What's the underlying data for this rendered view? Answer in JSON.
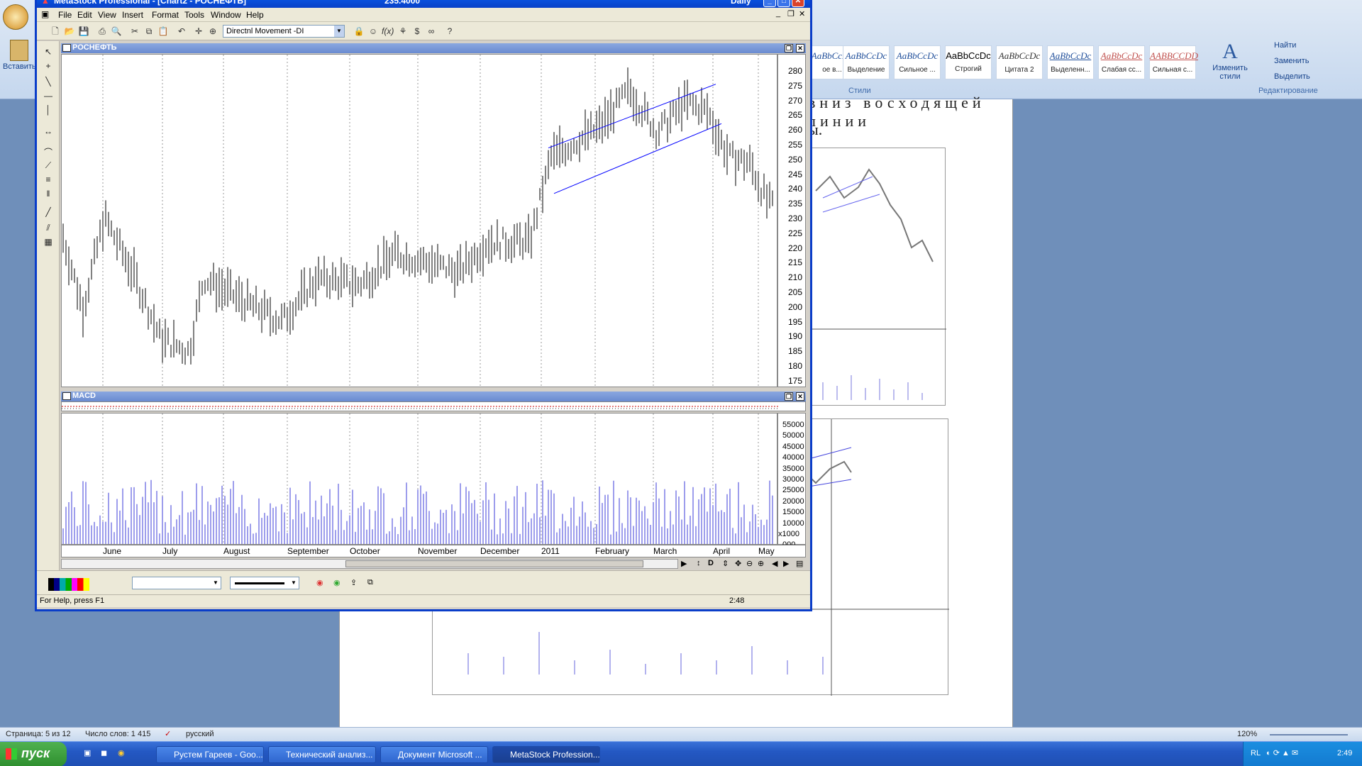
{
  "word": {
    "insert_label": "Вставить",
    "styles": [
      {
        "sample": "AaBbCcDc",
        "name": "ое в..."
      },
      {
        "sample": "AaBbCcDc",
        "name": "Выделение"
      },
      {
        "sample": "AaBbCcDc",
        "name": "Сильное ..."
      },
      {
        "sample": "AaBbCcDc",
        "name": "Строгий"
      },
      {
        "sample": "AaBbCcDc",
        "name": "Цитата 2"
      },
      {
        "sample": "AaBbCcDc",
        "name": "Выделенн..."
      },
      {
        "sample": "AaBbCcDc",
        "name": "Слабая сс..."
      },
      {
        "sample": "AABBCCDD",
        "name": "Сильная с..."
      }
    ],
    "change_styles": "Изменить стили",
    "styles_group": "Стили",
    "find": "Найти",
    "replace": "Заменить",
    "select": "Выделить",
    "editing_group": "Редактирование",
    "doc_text_line1": "вниз восходящей линии",
    "doc_text_line2": "ы.",
    "status": {
      "page": "Страница: 5 из 12",
      "words": "Число слов: 1 415",
      "lang": "русский",
      "zoom": "120%"
    }
  },
  "metastock": {
    "title": "MetaStock Professional - [Chart2 - РОСНЕФТЬ]",
    "price": "235.4000",
    "period": "Daily",
    "menu": [
      "File",
      "Edit",
      "View",
      "Insert",
      "Format",
      "Tools",
      "Window",
      "Help"
    ],
    "indicator_select": "Directnl Movement -DI",
    "pane1_title": "РОСНЕФТЬ",
    "pane2_title": "MACD",
    "price_ticks": [
      "280",
      "275",
      "270",
      "265",
      "260",
      "255",
      "250",
      "245",
      "240",
      "235",
      "230",
      "225",
      "220",
      "215",
      "210",
      "205",
      "200",
      "195",
      "190",
      "185",
      "180",
      "175"
    ],
    "volume_ticks": [
      "55000",
      "50000",
      "45000",
      "40000",
      "35000",
      "30000",
      "25000",
      "20000",
      "15000",
      "10000",
      "x1000",
      "000"
    ],
    "months": [
      "June",
      "July",
      "August",
      "September",
      "October",
      "November",
      "December",
      "2011",
      "February",
      "March",
      "April",
      "May"
    ],
    "status_help": "For Help, press F1",
    "status_time": "2:48"
  },
  "taskbar": {
    "start": "пуск",
    "tasks": [
      "Рустем Гареев - Goo...",
      "Технический анализ...",
      "Документ Microsoft ...",
      "MetaStock Profession..."
    ],
    "tray_lang": "RL",
    "clock": "2:49"
  },
  "colors": {
    "title_blue": "#0a3dc9",
    "channel": "#0000ff",
    "volume": "#3b3bd9"
  }
}
